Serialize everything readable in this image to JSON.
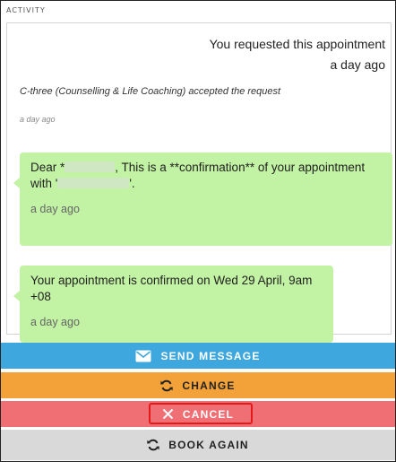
{
  "activity": {
    "heading": "ACTIVITY"
  },
  "feed": {
    "requested_line1": "You requested this appointment",
    "requested_line2": "a day ago",
    "accepted": "C-three (Counselling & Life Coaching) accepted the request",
    "accepted_time": "a day ago",
    "message1": {
      "part1": "Dear *",
      "part2": ", This is a **confirmation** of your appointment with '",
      "part3": "'.",
      "time": "a day ago"
    },
    "message2": {
      "text": "Your appointment is confirmed on Wed 29 April, 9am +08",
      "time": "a day ago"
    }
  },
  "actions": {
    "send_message": "SEND MESSAGE",
    "change": "CHANGE",
    "cancel": "CANCEL",
    "book_again": "BOOK AGAIN"
  },
  "colors": {
    "send": "#3ea7dd",
    "change": "#f3a23a",
    "cancel": "#ef6f74",
    "book_again": "#d9d9d9",
    "bubble": "#c2f2a3",
    "focus_outline": "#e21a1a"
  },
  "icons": [
    "envelope-icon",
    "refresh-icon",
    "close-icon",
    "refresh-icon"
  ]
}
